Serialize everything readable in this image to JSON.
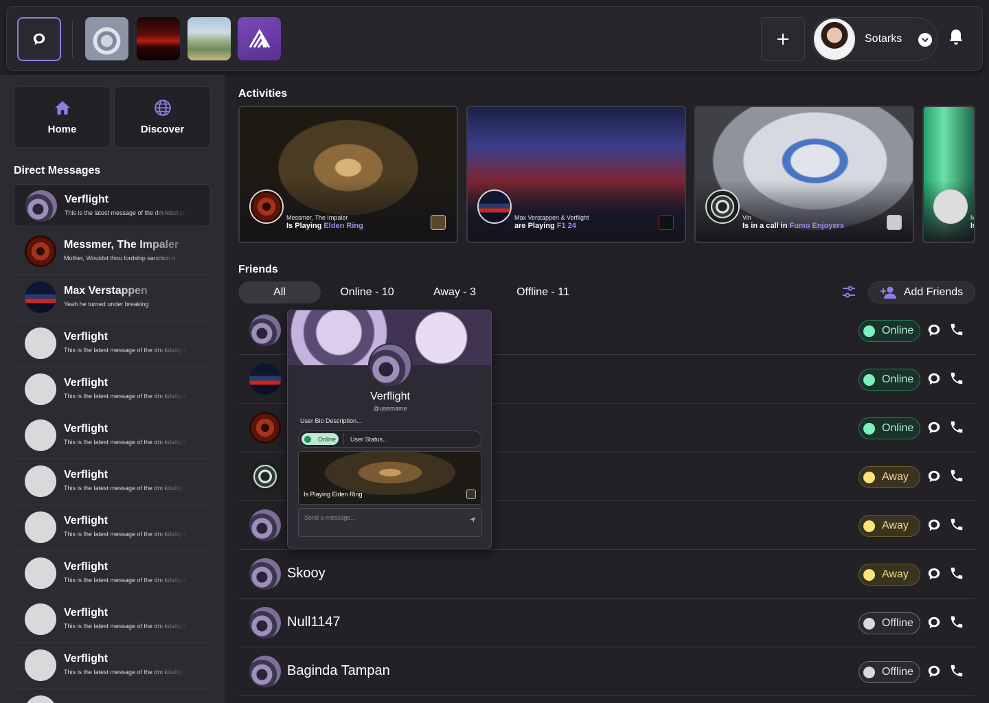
{
  "header": {
    "profile_name": "Sotarks",
    "servers": [
      "server-fumo",
      "server-city-night",
      "server-landscape",
      "server-purple-logo"
    ]
  },
  "nav": {
    "home_label": "Home",
    "discover_label": "Discover"
  },
  "direct_messages": {
    "title": "Direct Messages",
    "items": [
      {
        "name": "Verflight",
        "message": "This is the latest message of the dm kdalkjdlkajd",
        "avatar": "verflight"
      },
      {
        "name": "Messmer, The Impaler",
        "message": "Mother, Wouldst thou lordship sanction it",
        "avatar": "messmer"
      },
      {
        "name": "Max Verstappen",
        "message": "Yeah he turned under breaking",
        "avatar": "max"
      },
      {
        "name": "Verflight",
        "message": "This is the latest message of the dm kdalkjdlkajd",
        "avatar": "blank"
      },
      {
        "name": "Verflight",
        "message": "This is the latest message of the dm kdalkjdlkajd",
        "avatar": "blank"
      },
      {
        "name": "Verflight",
        "message": "This is the latest message of the dm kdalkjdlkajd",
        "avatar": "blank"
      },
      {
        "name": "Verflight",
        "message": "This is the latest message of the dm kdalkjdlkajd",
        "avatar": "blank"
      },
      {
        "name": "Verflight",
        "message": "This is the latest message of the dm kdalkjdlkajd",
        "avatar": "blank"
      },
      {
        "name": "Verflight",
        "message": "This is the latest message of the dm kdalkjdlkajd",
        "avatar": "blank"
      },
      {
        "name": "Verflight",
        "message": "This is the latest message of the dm kdalkjdlkajd",
        "avatar": "blank"
      },
      {
        "name": "Verflight",
        "message": "This is the latest message of the dm kdalkjdlkajd",
        "avatar": "blank"
      }
    ]
  },
  "activities": {
    "title": "Activities",
    "cards": [
      {
        "who": "Messmer, The Impaler",
        "verb": "Is Playing",
        "target": "Elden Ring"
      },
      {
        "who": "Max Verstappen & Verflight",
        "verb": "are Playing",
        "target": "F1 24"
      },
      {
        "who": "Vin",
        "verb": "Is in a call in",
        "target": "Fumo Enjoyers"
      },
      {
        "who": "M",
        "verb": "Is",
        "target": ""
      }
    ]
  },
  "friends": {
    "title": "Friends",
    "tabs": [
      "All",
      "Online - 10",
      "Away - 3",
      "Offline - 11"
    ],
    "add_friends_label": "Add Friends",
    "list": [
      {
        "name": "",
        "status": "Online",
        "avatar": "verflight"
      },
      {
        "name": "",
        "status": "Online",
        "avatar": "max"
      },
      {
        "name": "",
        "status": "Online",
        "avatar": "messmer"
      },
      {
        "name": "",
        "status": "Away",
        "avatar": "nature"
      },
      {
        "name": "",
        "status": "Away",
        "avatar": "verflight"
      },
      {
        "name": "Skooy",
        "status": "Away",
        "avatar": "verflight"
      },
      {
        "name": "Null1147",
        "status": "Offline",
        "avatar": "verflight"
      },
      {
        "name": "Baginda Tampan",
        "status": "Offline",
        "avatar": "verflight"
      }
    ]
  },
  "popup": {
    "name": "Verflight",
    "username": "@username",
    "bio": "User Bio Description...",
    "status_chip": "Online",
    "status_text": "User Status...",
    "activity_text": "Is Playing Elden Ring",
    "message_placeholder": "Send a message..."
  },
  "colors": {
    "accent": "#8f7ce6",
    "online": "#7ef0bd",
    "away": "#fbe57b",
    "offline": "#d9d9dc",
    "game_link": "#9b8cf0"
  }
}
